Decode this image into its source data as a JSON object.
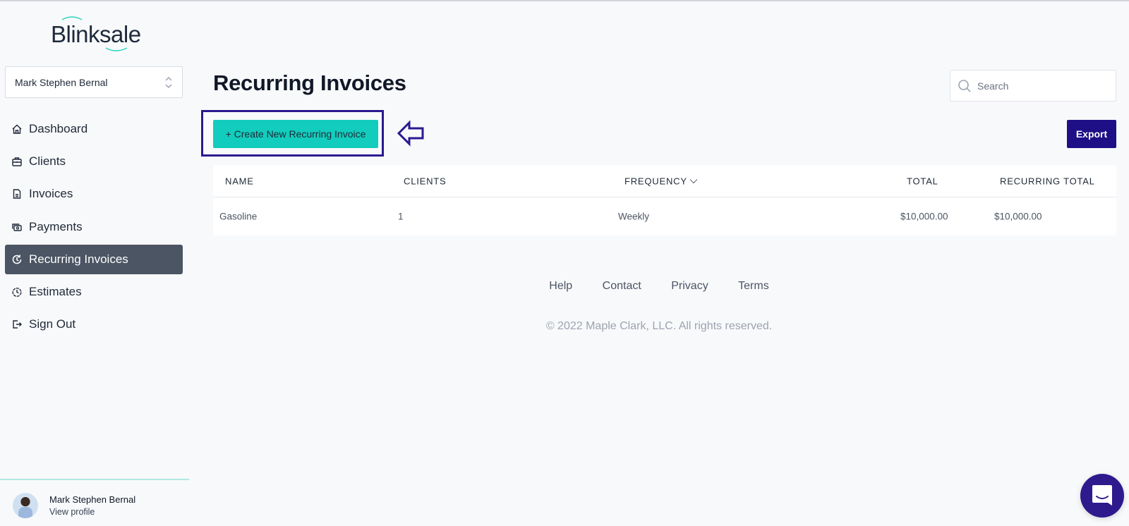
{
  "app": {
    "name": "Blinksale"
  },
  "account_selector": {
    "value": "Mark Stephen Bernal"
  },
  "sidebar": {
    "items": [
      {
        "label": "Dashboard",
        "icon": "home-icon",
        "active": false
      },
      {
        "label": "Clients",
        "icon": "briefcase-icon",
        "active": false
      },
      {
        "label": "Invoices",
        "icon": "document-icon",
        "active": false
      },
      {
        "label": "Payments",
        "icon": "cash-icon",
        "active": false
      },
      {
        "label": "Recurring Invoices",
        "icon": "refresh-clock-icon",
        "active": true
      },
      {
        "label": "Estimates",
        "icon": "timer-icon",
        "active": false
      },
      {
        "label": "Sign Out",
        "icon": "logout-icon",
        "active": false
      }
    ],
    "profile": {
      "name": "Mark Stephen Bernal",
      "link": "View profile"
    }
  },
  "main": {
    "title": "Recurring Invoices",
    "search": {
      "placeholder": "Search",
      "value": ""
    },
    "create_button": "+ Create New Recurring Invoice",
    "export_button": "Export",
    "table": {
      "columns": [
        "NAME",
        "CLIENTS",
        "FREQUENCY",
        "TOTAL",
        "RECURRING TOTAL"
      ],
      "sorted_column": "FREQUENCY",
      "rows": [
        {
          "name": "Gasoline",
          "clients": "1",
          "frequency": "Weekly",
          "total": "$10,000.00",
          "recurring_total": "$10,000.00"
        }
      ]
    }
  },
  "footer": {
    "links": [
      "Help",
      "Contact",
      "Privacy",
      "Terms"
    ],
    "copyright": "© 2022 Maple Clark, LLC. All rights reserved."
  },
  "colors": {
    "accent_teal": "#12cdbd",
    "primary_indigo": "#1f0f86",
    "sidebar_active": "#4b5563",
    "annotation": "#2a1a8f"
  }
}
